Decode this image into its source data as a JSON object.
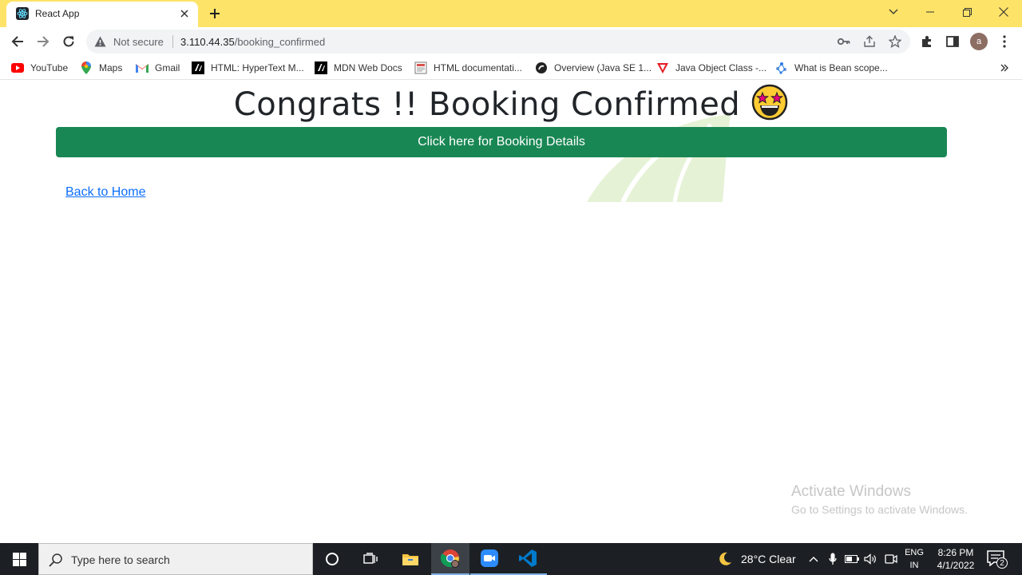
{
  "browser": {
    "tab": {
      "title": "React App"
    },
    "address": {
      "security_label": "Not secure",
      "host": "3.110.44.35",
      "path": "/booking_confirmed"
    },
    "profile_initial": "a",
    "bookmarks": [
      {
        "label": "YouTube",
        "icon": "youtube-icon"
      },
      {
        "label": "Maps",
        "icon": "maps-icon"
      },
      {
        "label": "Gmail",
        "icon": "gmail-icon"
      },
      {
        "label": "HTML: HyperText M...",
        "icon": "mdn-icon"
      },
      {
        "label": "MDN Web Docs",
        "icon": "mdn-icon"
      },
      {
        "label": "HTML documentati...",
        "icon": "doc-icon"
      },
      {
        "label": "Overview (Java SE 1...",
        "icon": "java-icon"
      },
      {
        "label": "Java Object Class -...",
        "icon": "javatpoint-icon"
      },
      {
        "label": "What is Bean scope...",
        "icon": "bean-icon"
      }
    ]
  },
  "page": {
    "heading": "Congrats !! Booking Confirmed",
    "details_button": "Click here for Booking Details",
    "home_link": "Back to Home",
    "watermark_title": "Activate Windows",
    "watermark_subtitle": "Go to Settings to activate Windows."
  },
  "taskbar": {
    "search_placeholder": "Type here to search",
    "weather": "28°C  Clear",
    "lang_top": "ENG",
    "lang_bottom": "IN",
    "time": "8:26 PM",
    "date": "4/1/2022",
    "notification_count": "2"
  },
  "colors": {
    "tabstrip": "#fde368",
    "success_button": "#198754",
    "link": "#0d6efd",
    "taskbar": "#1c2024"
  }
}
